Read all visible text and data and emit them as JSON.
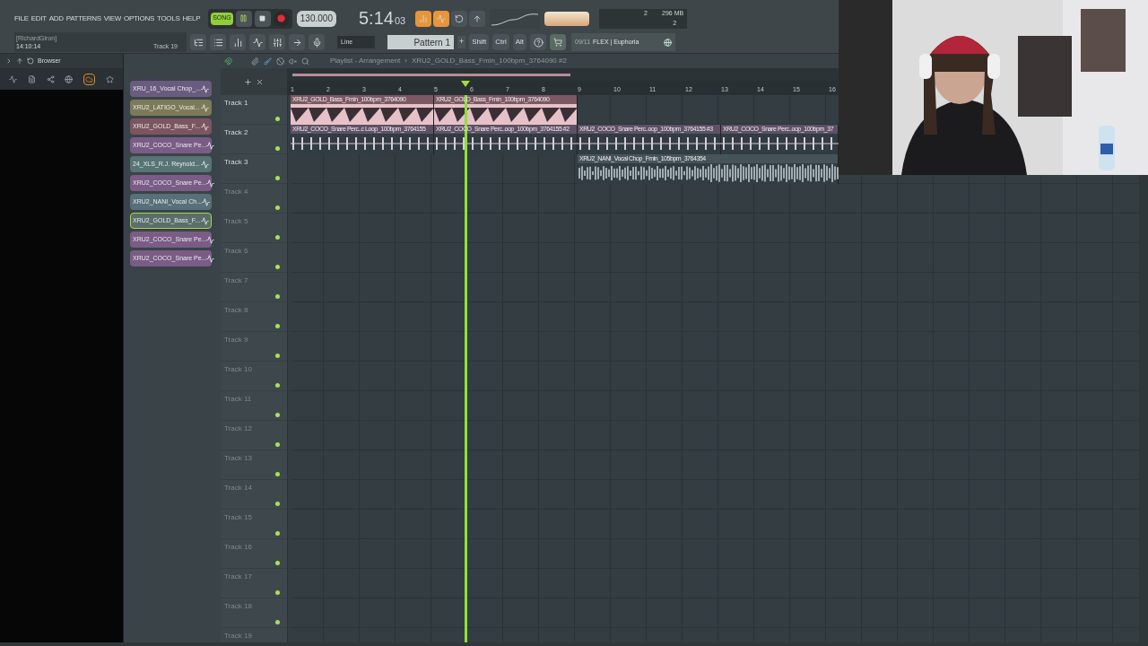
{
  "menu": [
    "FILE",
    "EDIT",
    "ADD",
    "PATTERNS",
    "VIEW",
    "OPTIONS",
    "TOOLS",
    "HELP"
  ],
  "transport": {
    "song_mode": "SONG",
    "song_selected": true,
    "tempo": "130.000",
    "time": "5:14",
    "time_small": "03"
  },
  "hint_panel": {
    "user": "[RichardGiron]",
    "clock": "14:10:14",
    "track": "Track 19"
  },
  "snap": "Line",
  "pattern": "Pattern 1",
  "pattern_add": "+",
  "modifiers": [
    "Shift",
    "Ctrl",
    "Alt"
  ],
  "news": {
    "date": "09/11",
    "title": "FLEX | Euphoria"
  },
  "cpu": {
    "value": "2",
    "memory": "296 MB",
    "polyphony": "2"
  },
  "browser": {
    "title": "Browser"
  },
  "patterns": [
    {
      "label": "XRU_16_Vocal Chop_...",
      "color": "#6a5b80",
      "selected": false
    },
    {
      "label": "XRU2_LATIGO_Vocal...",
      "color": "#7c7a58",
      "selected": false
    },
    {
      "label": "XRU2_GOLD_Bass_F...",
      "color": "#7c5561",
      "selected": false
    },
    {
      "label": "XRU2_COCO_Snare Pe...",
      "color": "#7a5c86",
      "selected": false
    },
    {
      "label": "24_XLS_R.J. Reynold...",
      "color": "#587474",
      "selected": false
    },
    {
      "label": "XRU2_COCO_Snare Pe...",
      "color": "#7a5c86",
      "selected": false
    },
    {
      "label": "XRU2_NANI_Vocal Ch...",
      "color": "#57707a",
      "selected": false
    },
    {
      "label": "XRU2_GOLD_Bass_F...",
      "color": "#5a6e6a",
      "selected": true
    },
    {
      "label": "XRU2_COCO_Snare Pe...",
      "color": "#7a5c86",
      "selected": false
    },
    {
      "label": "XRU2_COCO_Snare Pe...",
      "color": "#7a5c86",
      "selected": false
    }
  ],
  "playlist": {
    "title": "Playlist - Arrangement",
    "separator": "›",
    "pattern": "XRU2_GOLD_Bass_Fmin_100bpm_3764090 #2",
    "bars": [
      "1",
      "2",
      "3",
      "4",
      "5",
      "6",
      "7",
      "8",
      "9",
      "10",
      "11",
      "12",
      "13",
      "14",
      "15",
      "16"
    ],
    "playhead": {
      "level": 0.208
    },
    "tracks": [
      {
        "name": "Track 1",
        "clips": [
          {
            "kind": "bass",
            "label": "XRU2_GOLD_Bass_Fmin_100bpm_3764090"
          },
          {
            "kind": "bass",
            "label": "XRU2_GOLD_Bass_Fmin_100bpm_3764090"
          }
        ]
      },
      {
        "name": "Track 2",
        "clips": [
          {
            "kind": "perc",
            "label": "XRU2_COCO_Snare Perc..c Loop_100bpm_3764155"
          },
          {
            "kind": "perc",
            "label": "XRU2_COCO_Snare Perc..oop_100bpm_3764155 #2"
          },
          {
            "kind": "perc",
            "label": "XRU2_COCO_Snare Perc..oop_100bpm_3764155 #3"
          },
          {
            "kind": "perc",
            "label": "XRU2_COCO_Snare Perc..oop_100bpm_37"
          }
        ]
      },
      {
        "name": "Track 3",
        "clips": [
          {
            "kind": "vocal",
            "label": "XRU2_NANI_Vocal Chop_Fmin_105bpm_3764354"
          }
        ]
      },
      {
        "name": "Track 4"
      },
      {
        "name": "Track 5"
      },
      {
        "name": "Track 6"
      },
      {
        "name": "Track 7"
      },
      {
        "name": "Track 8"
      },
      {
        "name": "Track 9"
      },
      {
        "name": "Track 10"
      },
      {
        "name": "Track 11"
      },
      {
        "name": "Track 12"
      },
      {
        "name": "Track 13"
      },
      {
        "name": "Track 14"
      },
      {
        "name": "Track 15"
      },
      {
        "name": "Track 16"
      },
      {
        "name": "Track 17"
      },
      {
        "name": "Track 18"
      },
      {
        "name": "Track 19"
      }
    ]
  },
  "webcam": {
    "kind": "picture"
  }
}
